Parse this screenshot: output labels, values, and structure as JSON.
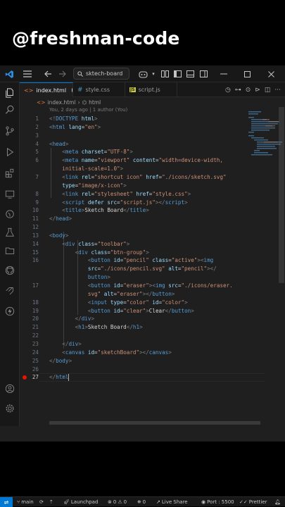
{
  "watermark": "@freshman-code",
  "titlebar": {
    "search_text": "sktech-board"
  },
  "tabs": [
    {
      "label": "index.html",
      "modified": true,
      "active": true
    },
    {
      "label": "style.css",
      "active": false
    },
    {
      "label": "script.js",
      "active": false
    }
  ],
  "breadcrumb": [
    "index.html",
    "html"
  ],
  "blame": "You, 2 days ago | 1 author (You)",
  "code_lines": [
    {
      "n": "1",
      "html": "<span class='tk-p'>&lt;!</span><span class='tk-t'>DOCTYPE</span> <span class='tk-a'>html</span><span class='tk-p'>&gt;</span>"
    },
    {
      "n": "2",
      "html": "<span class='tk-p'>&lt;</span><span class='tk-t'>html</span> <span class='tk-a'>lang</span><span class='tk-x'>=</span><span class='tk-s'>\"en\"</span><span class='tk-p'>&gt;</span>"
    },
    {
      "n": "3",
      "html": ""
    },
    {
      "n": "4",
      "html": "<span class='tk-p'>&lt;</span><span class='tk-t'>head</span><span class='tk-p'>&gt;</span>"
    },
    {
      "n": "5",
      "html": "    <span class='tk-p'>&lt;</span><span class='tk-t'>meta</span> <span class='tk-a'>charset</span><span class='tk-x'>=</span><span class='tk-s'>\"UTF-8\"</span><span class='tk-p'>&gt;</span>"
    },
    {
      "n": "6",
      "html": "    <span class='tk-p'>&lt;</span><span class='tk-t'>meta</span> <span class='tk-a'>name</span><span class='tk-x'>=</span><span class='tk-s'>\"viewport\"</span> <span class='tk-a'>content</span><span class='tk-x'>=</span><span class='tk-s'>\"width=device-width,</span>"
    },
    {
      "n": "",
      "html": "    <span class='tk-s'>initial-scale=1.0\"</span><span class='tk-p'>&gt;</span>"
    },
    {
      "n": "7",
      "html": "    <span class='tk-p'>&lt;</span><span class='tk-t'>link</span> <span class='tk-a'>rel</span><span class='tk-x'>=</span><span class='tk-s'>\"shortcut icon\"</span> <span class='tk-a'>href</span><span class='tk-x'>=</span><span class='tk-s'>\"./icons/sketch.svg\"</span>"
    },
    {
      "n": "",
      "html": "    <span class='tk-a'>type</span><span class='tk-x'>=</span><span class='tk-s'>\"image/x-icon\"</span><span class='tk-p'>&gt;</span>"
    },
    {
      "n": "8",
      "html": "    <span class='tk-p'>&lt;</span><span class='tk-t'>link</span> <span class='tk-a'>rel</span><span class='tk-x'>=</span><span class='tk-s'>\"stylesheet\"</span> <span class='tk-a'>href</span><span class='tk-x'>=</span><span class='tk-s'>\"style.css\"</span><span class='tk-p'>&gt;</span>"
    },
    {
      "n": "9",
      "html": "    <span class='tk-p'>&lt;</span><span class='tk-t'>script</span> <span class='tk-a'>defer</span> <span class='tk-a'>src</span><span class='tk-x'>=</span><span class='tk-s'>\"script.js\"</span><span class='tk-p'>&gt;&lt;/</span><span class='tk-t'>script</span><span class='tk-p'>&gt;</span>"
    },
    {
      "n": "10",
      "html": "    <span class='tk-p'>&lt;</span><span class='tk-t'>title</span><span class='tk-p'>&gt;</span><span class='tk-x'>Sketch Board</span><span class='tk-p'>&lt;/</span><span class='tk-t'>title</span><span class='tk-p'>&gt;</span>"
    },
    {
      "n": "11",
      "html": "<span class='tk-p'>&lt;/</span><span class='tk-t'>head</span><span class='tk-p'>&gt;</span>"
    },
    {
      "n": "12",
      "html": ""
    },
    {
      "n": "13",
      "html": "<span class='tk-p'>&lt;</span><span class='tk-t'>body</span><span class='tk-p'>&gt;</span>"
    },
    {
      "n": "14",
      "html": "    <span class='tk-p'>&lt;</span><span class='tk-t'>div</span> <span class='tk-a'>class</span><span class='tk-x'>=</span><span class='tk-s'>\"toolbar\"</span><span class='tk-p'>&gt;</span>"
    },
    {
      "n": "15",
      "html": "        <span class='tk-p'>&lt;</span><span class='tk-t'>div</span> <span class='tk-a'>class</span><span class='tk-x'>=</span><span class='tk-s'>\"btn-group\"</span><span class='tk-p'>&gt;</span>"
    },
    {
      "n": "16",
      "html": "            <span class='tk-p'>&lt;</span><span class='tk-t'>button</span> <span class='tk-a'>id</span><span class='tk-x'>=</span><span class='tk-s'>\"pencil\"</span> <span class='tk-a'>class</span><span class='tk-x'>=</span><span class='tk-s'>\"active\"</span><span class='tk-p'>&gt;&lt;</span><span class='tk-t'>img</span>"
    },
    {
      "n": "",
      "html": "            <span class='tk-a'>src</span><span class='tk-x'>=</span><span class='tk-s'>\"./icons/pencil.svg\"</span> <span class='tk-a'>alt</span><span class='tk-x'>=</span><span class='tk-s'>\"pencil\"</span><span class='tk-p'>&gt;&lt;/</span>"
    },
    {
      "n": "",
      "html": "            <span class='tk-t'>button</span><span class='tk-p'>&gt;</span>"
    },
    {
      "n": "17",
      "html": "            <span class='tk-p'>&lt;</span><span class='tk-t'>button</span> <span class='tk-a'>id</span><span class='tk-x'>=</span><span class='tk-s'>\"eraser\"</span><span class='tk-p'>&gt;&lt;</span><span class='tk-t'>img</span> <span class='tk-a'>src</span><span class='tk-x'>=</span><span class='tk-s'>\"./icons/eraser.</span>"
    },
    {
      "n": "",
      "html": "            <span class='tk-s'>svg\"</span> <span class='tk-a'>alt</span><span class='tk-x'>=</span><span class='tk-s'>\"eraser\"</span><span class='tk-p'>&gt;&lt;/</span><span class='tk-t'>button</span><span class='tk-p'>&gt;</span>"
    },
    {
      "n": "18",
      "html": "            <span class='tk-p'>&lt;</span><span class='tk-t'>input</span> <span class='tk-a'>type</span><span class='tk-x'>=</span><span class='tk-s'>\"color\"</span> <span class='tk-a'>id</span><span class='tk-x'>=</span><span class='tk-s'>\"color\"</span><span class='tk-p'>&gt;</span>"
    },
    {
      "n": "19",
      "html": "            <span class='tk-p'>&lt;</span><span class='tk-t'>button</span> <span class='tk-a'>id</span><span class='tk-x'>=</span><span class='tk-s'>\"clear\"</span><span class='tk-p'>&gt;</span><span class='tk-x'>Clear</span><span class='tk-p'>&lt;/</span><span class='tk-t'>button</span><span class='tk-p'>&gt;</span>"
    },
    {
      "n": "20",
      "html": "        <span class='tk-p'>&lt;/</span><span class='tk-t'>div</span><span class='tk-p'>&gt;</span>"
    },
    {
      "n": "21",
      "html": "        <span class='tk-p'>&lt;</span><span class='tk-t'>h1</span><span class='tk-p'>&gt;</span><span class='tk-x'>Sketch Board</span><span class='tk-p'>&lt;/</span><span class='tk-t'>h1</span><span class='tk-p'>&gt;</span>"
    },
    {
      "n": "22",
      "html": ""
    },
    {
      "n": "23",
      "html": "    <span class='tk-p'>&lt;/</span><span class='tk-t'>div</span><span class='tk-p'>&gt;</span>"
    },
    {
      "n": "24",
      "html": "    <span class='tk-p'>&lt;</span><span class='tk-t'>canvas</span> <span class='tk-a'>id</span><span class='tk-x'>=</span><span class='tk-s'>\"sketchBoard\"</span><span class='tk-p'>&gt;&lt;/</span><span class='tk-t'>canvas</span><span class='tk-p'>&gt;</span>"
    },
    {
      "n": "25",
      "html": "<span class='tk-p'>&lt;/</span><span class='tk-t'>body</span><span class='tk-p'>&gt;</span>"
    },
    {
      "n": "26",
      "html": ""
    },
    {
      "n": "27",
      "html": "<span class='tk-p'>&lt;/</span><span class='tk-t'>html</span>"
    }
  ],
  "status": {
    "branch": "main",
    "launchpad": "Launchpad",
    "errors": "0",
    "warnings": "0",
    "ports": "0",
    "live_share": "Live Share",
    "port": "Port : 5500",
    "prettier": "Prettier"
  },
  "colors": {
    "accent": "#0078d4",
    "breakpoint": "#e51400"
  }
}
